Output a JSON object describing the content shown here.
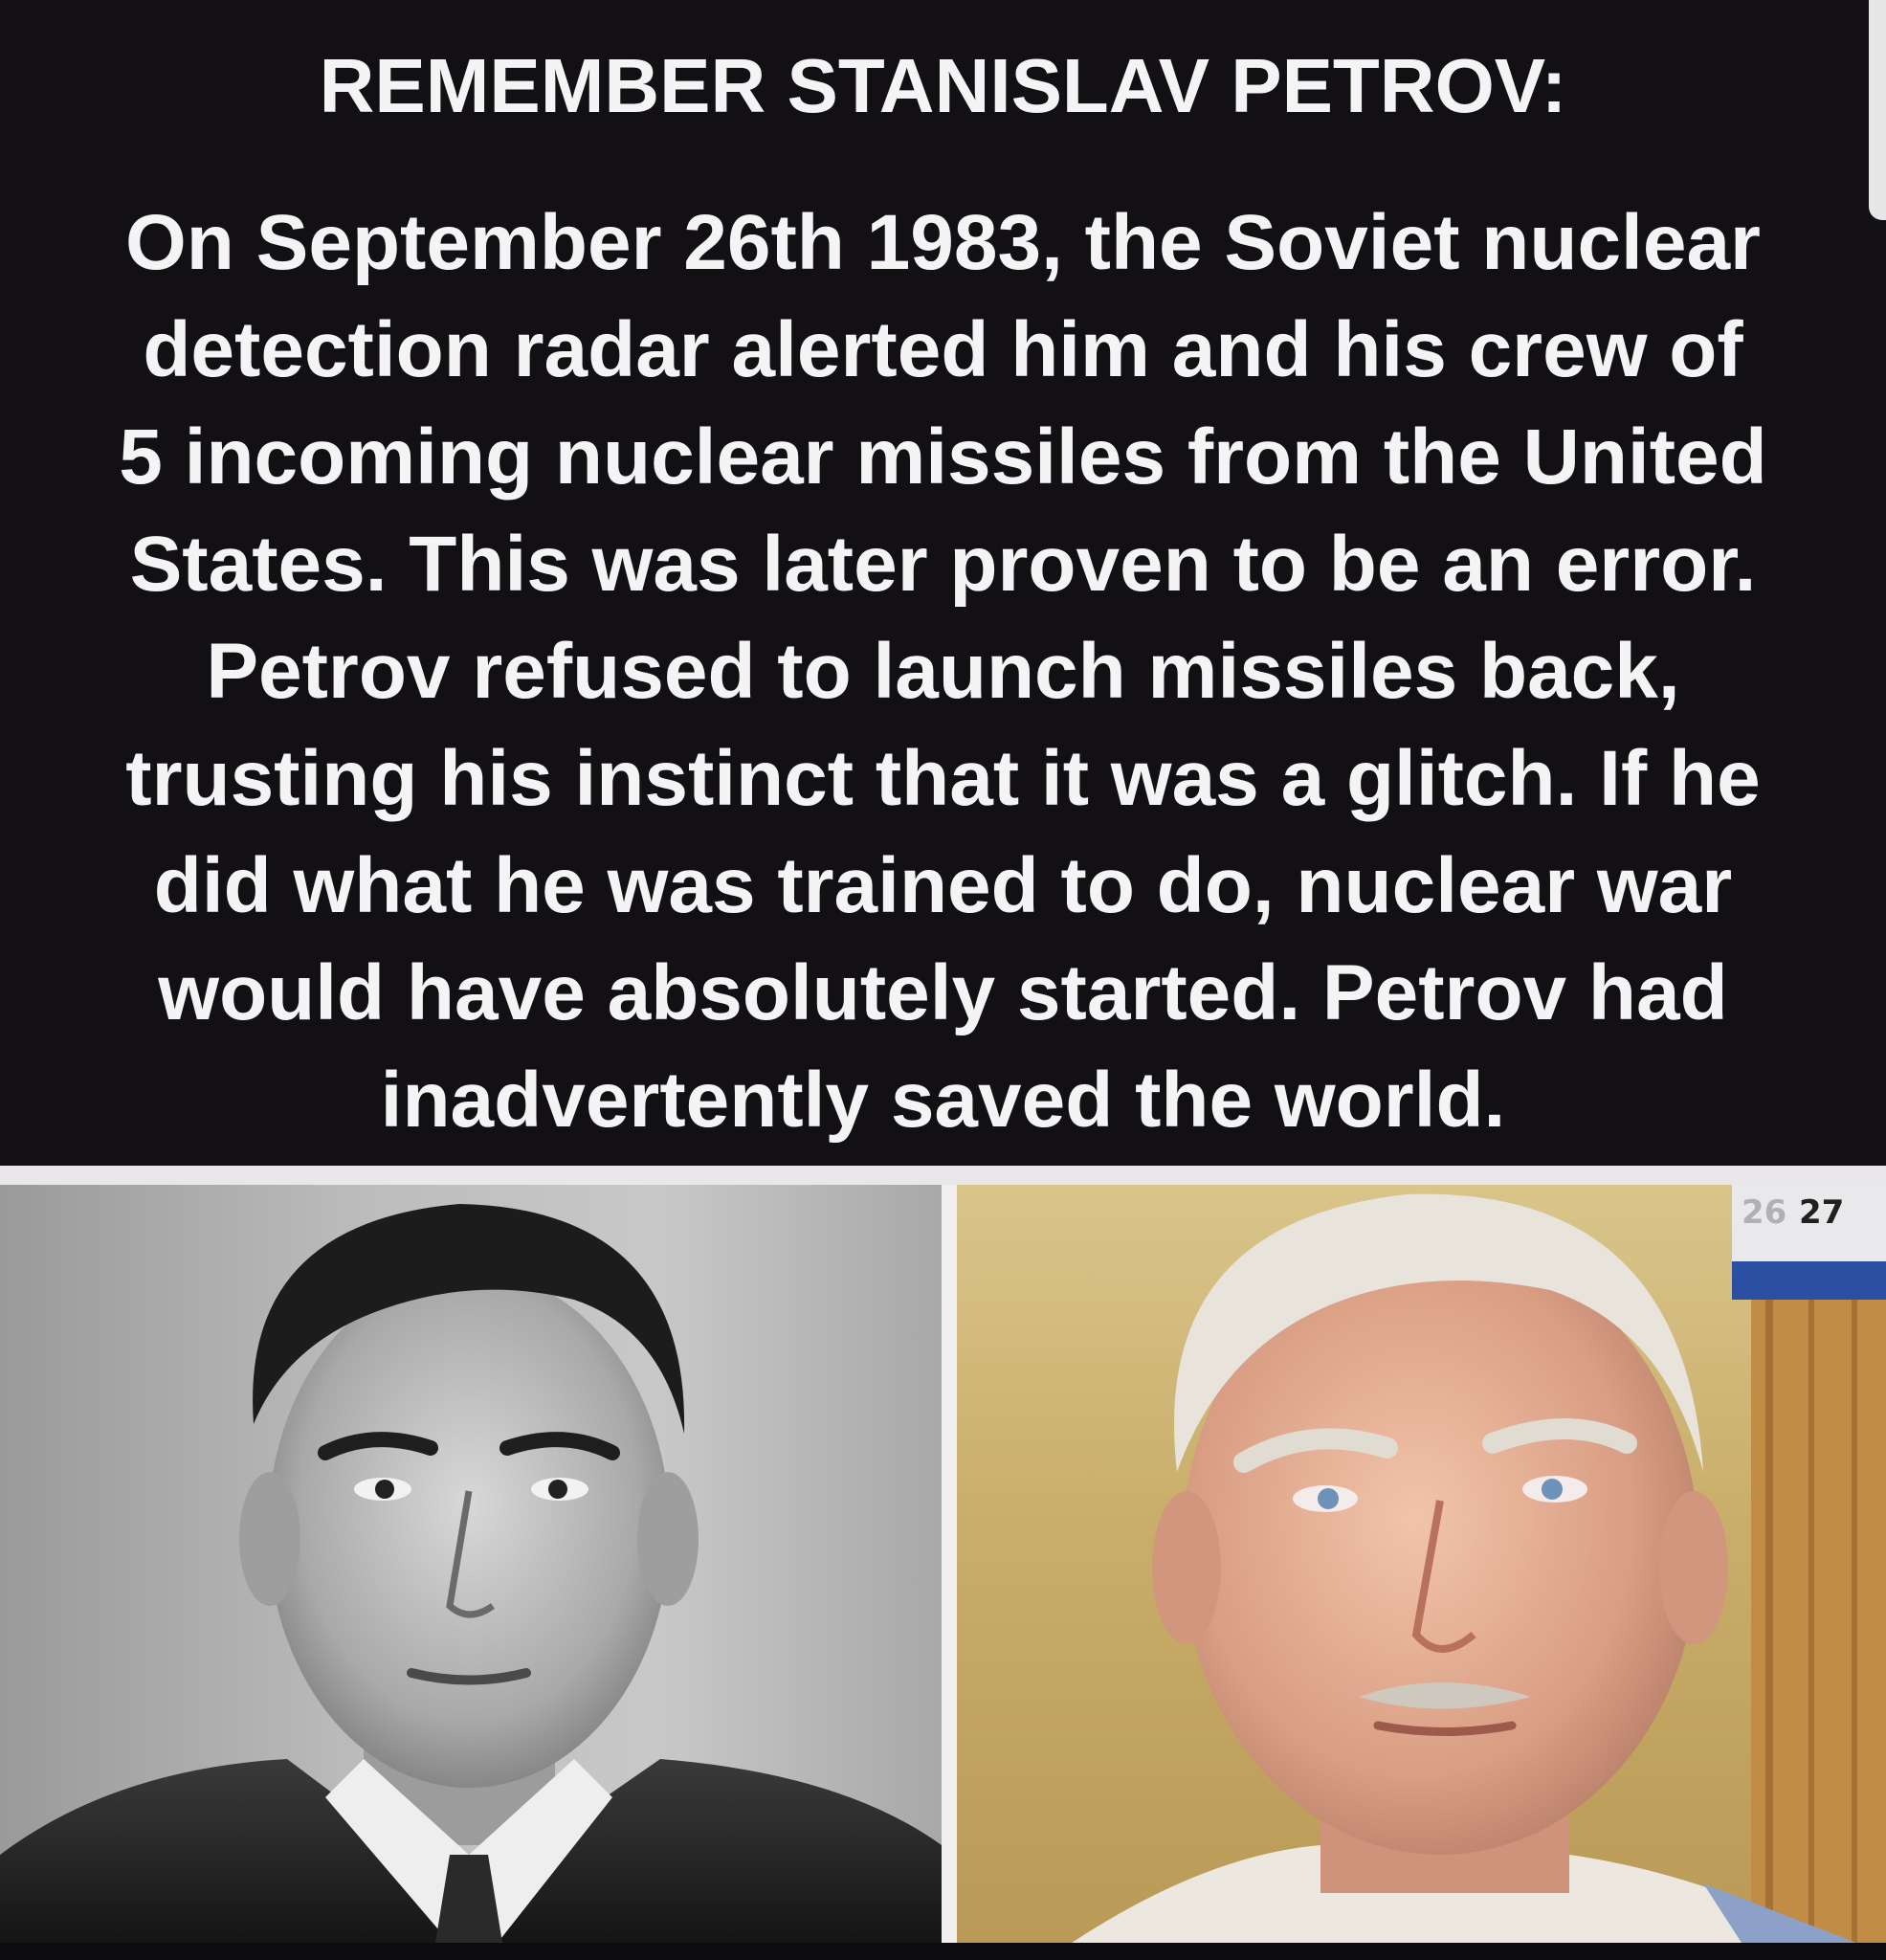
{
  "headline": "REMEMBER STANISLAV PETROV:",
  "body_lines": [
    "On September 26th 1983, the Soviet nuclear",
    "detection radar alerted him and his crew of",
    "5 incoming nuclear missiles from the United",
    "States. This was later proven to be an error.",
    "Petrov refused to launch missiles back,",
    "trusting his instinct that it was a glitch. If he",
    "did what he was trained to do, nuclear war",
    "would have absolutely started. Petrov had",
    "inadvertently saved the world."
  ],
  "calendar_numbers": [
    "26",
    "27"
  ],
  "colors": {
    "background": "#121014",
    "text": "#f4f4f4",
    "divider": "#e9e7ea",
    "wall_yellow": "#c9ad6a"
  }
}
